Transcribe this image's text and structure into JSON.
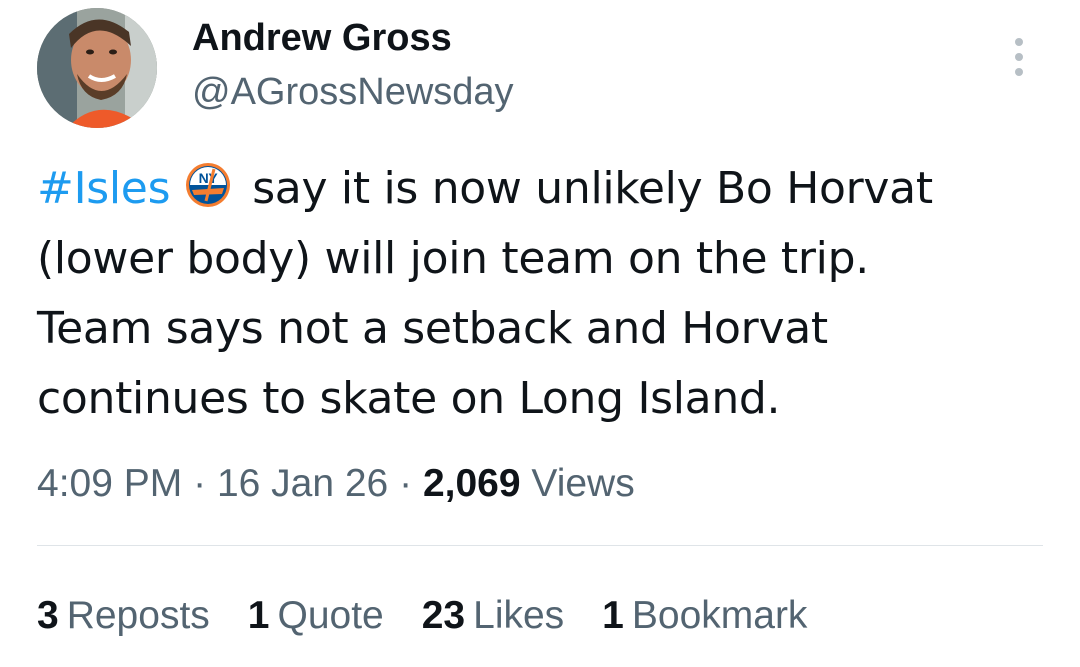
{
  "author": {
    "display_name": "Andrew Gross",
    "handle": "@AGrossNewsday"
  },
  "tweet": {
    "hashtag": "#Isles",
    "hashtag_icon": "new-york-islanders-logo",
    "line1_rest": "say it is now unlikely Bo Horvat",
    "line2": "(lower body) will join team on the trip.",
    "line3": "Team says not a setback and Horvat",
    "line4": "continues to skate on Long Island."
  },
  "meta": {
    "time": "4:09 PM",
    "sep1": "·",
    "date": "16 Jan 26",
    "sep2": "·",
    "views_count": "2,069",
    "views_label": "Views"
  },
  "stats": {
    "reposts_count": "3",
    "reposts_label": "Reposts",
    "quotes_count": "1",
    "quotes_label": "Quote",
    "likes_count": "23",
    "likes_label": "Likes",
    "bookmarks_count": "1",
    "bookmarks_label": "Bookmark"
  },
  "colors": {
    "accent": "#1d9bf0",
    "text_primary": "#0f1419",
    "text_secondary": "#536471",
    "divider": "#dfe4e8"
  },
  "icons": {
    "more": "more-vertical-icon",
    "avatar": "avatar"
  }
}
